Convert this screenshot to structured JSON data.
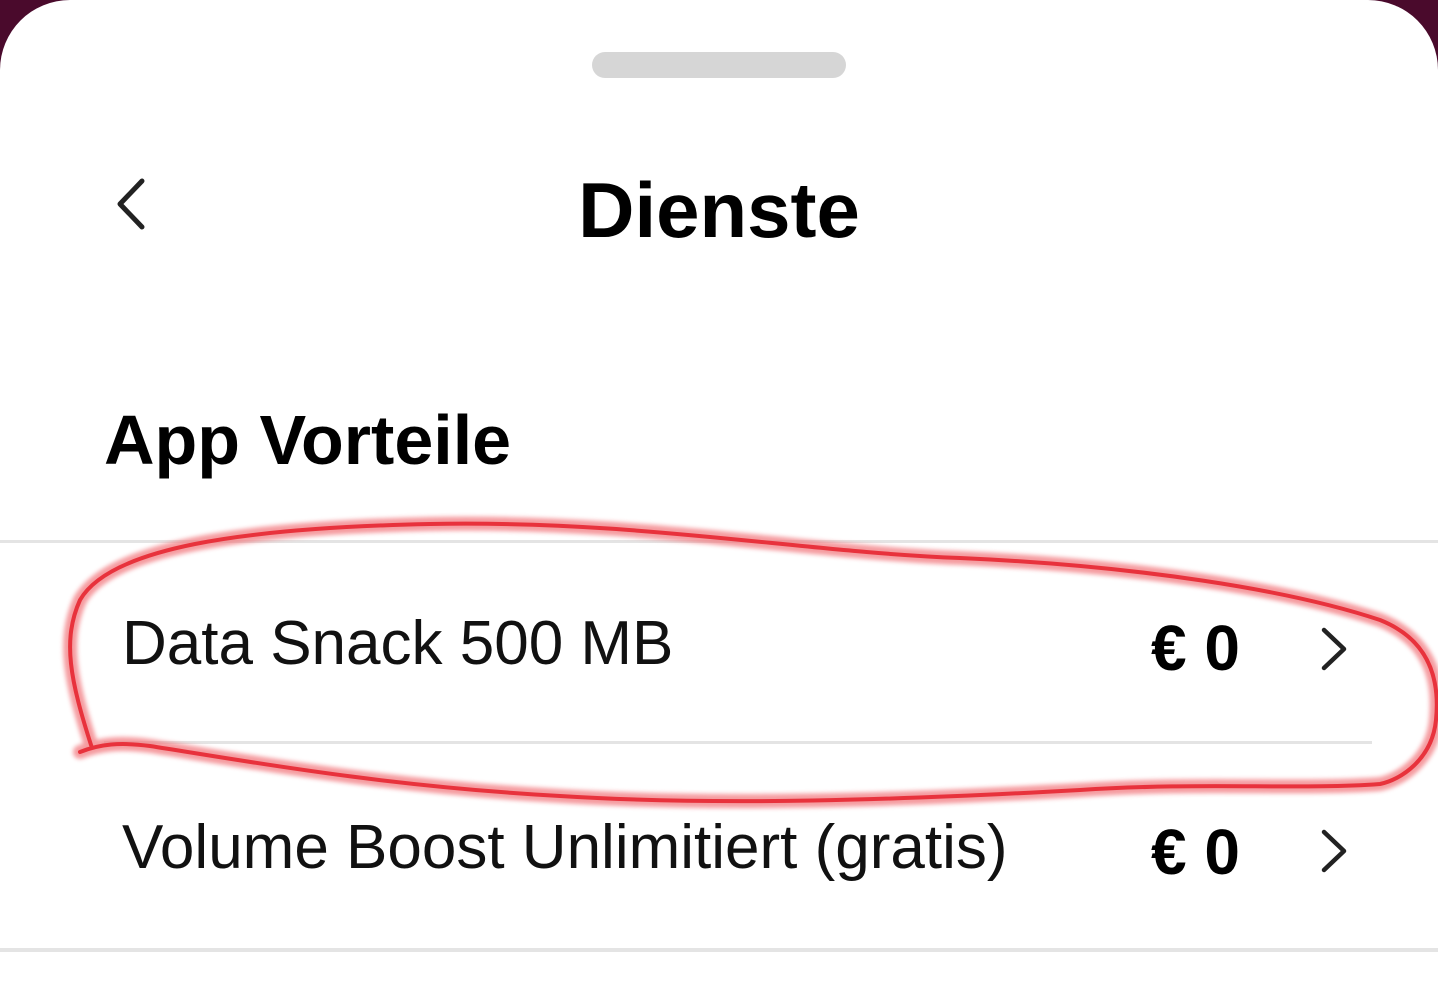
{
  "header": {
    "title": "Dienste",
    "back_icon": "chevron-left-icon"
  },
  "section": {
    "title": "App Vorteile"
  },
  "services": [
    {
      "label": "Data Snack 500 MB",
      "price": "€ 0",
      "icon": "chevron-right-icon",
      "highlighted": true
    },
    {
      "label": "Volume Boost Unlimitiert (gratis)",
      "price": "€ 0",
      "icon": "chevron-right-icon",
      "highlighted": false
    }
  ],
  "colors": {
    "backdrop": "#4a0a2c",
    "sheet": "#ffffff",
    "annotation": "#e8323c"
  }
}
